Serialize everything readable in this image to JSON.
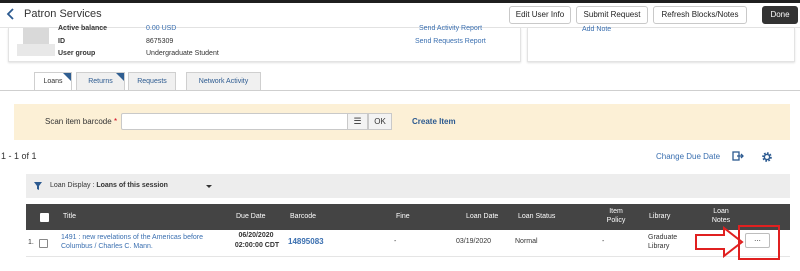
{
  "header": {
    "title": "Patron Services",
    "buttons": {
      "edit_user_info": "Edit User Info",
      "submit_request": "Submit Request",
      "refresh": "Refresh Blocks/Notes",
      "done": "Done"
    }
  },
  "patron": {
    "fields": [
      {
        "label": "Active balance",
        "value": "0.00 USD"
      },
      {
        "label": "ID",
        "value": "8675309"
      },
      {
        "label": "User group",
        "value": "Undergraduate Student"
      }
    ],
    "send_activity_report": "Send Activity Report",
    "send_requests_report": "Send Requests Report",
    "add_note": "Add Note"
  },
  "tabs": [
    {
      "label": "Loans",
      "active": true
    },
    {
      "label": "Returns",
      "active": false
    },
    {
      "label": "Requests",
      "active": false
    },
    {
      "label": "Network Activity",
      "active": false
    }
  ],
  "scan": {
    "label": "Scan item barcode",
    "required_mark": "*",
    "input_value": "",
    "list_icon": "list-icon",
    "ok_label": "OK",
    "create_item": "Create Item"
  },
  "results": {
    "count": "1 - 1 of 1",
    "change_due_date": "Change Due Date"
  },
  "filter": {
    "prefix": "Loan Display :",
    "value": "Loans of this session"
  },
  "table": {
    "headers": {
      "title": "Title",
      "due_date": "Due Date",
      "barcode": "Barcode",
      "fine": "Fine",
      "loan_date": "Loan Date",
      "loan_status": "Loan Status",
      "item_policy": "Item Policy",
      "library": "Library",
      "loan_notes": "Loan Notes"
    },
    "rows": [
      {
        "index": "1.",
        "title": "1491 : new revelations of the Americas before Columbus / Charles C. Mann.",
        "due_date": "06/20/2020",
        "due_time": "02:00:00 CDT",
        "barcode": "14895083",
        "fine": "-",
        "loan_date": "03/19/2020",
        "loan_status": "Normal",
        "item_policy": "-",
        "library": "Graduate Library",
        "more_label": "..."
      }
    ]
  },
  "colors": {
    "accent": "#2c5a90",
    "scan_bg": "#fcf0d6",
    "header_bg": "#444444",
    "highlight": "#e02020"
  }
}
